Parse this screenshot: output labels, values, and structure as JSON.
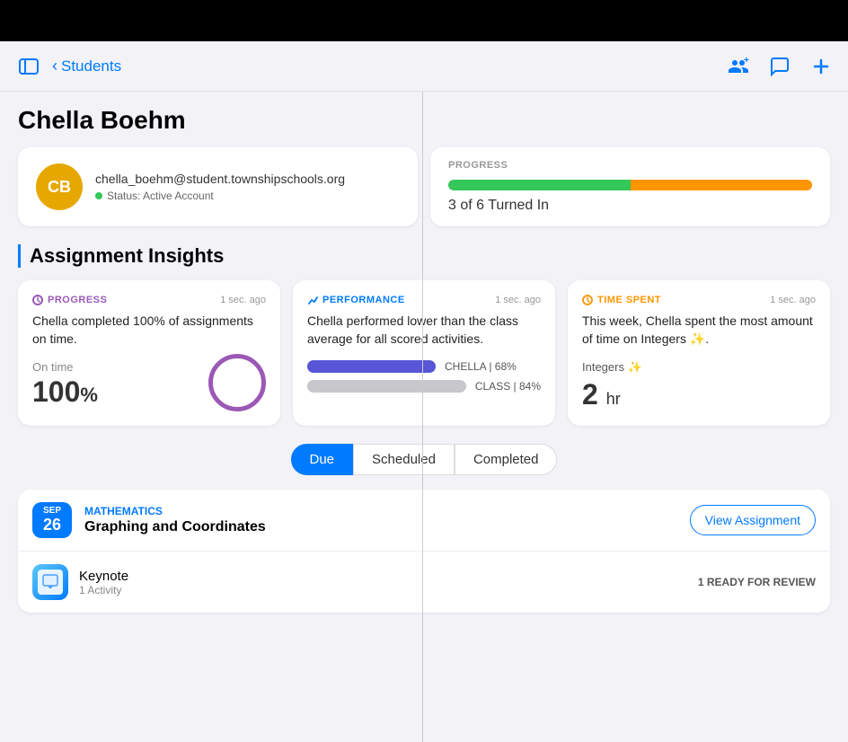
{
  "topBar": {
    "backLabel": "Students",
    "icons": [
      "person-add-icon",
      "chat-icon",
      "plus-icon"
    ]
  },
  "student": {
    "name": "Chella Boehm",
    "initials": "CB",
    "email": "chella_boehm@student.townshipschools.org",
    "statusLabel": "Status: Active Account",
    "avatarBg": "#e6a800"
  },
  "progress": {
    "label": "PROGRESS",
    "text": "3 of 6 Turned In",
    "greenPct": 50,
    "orangePct": 50
  },
  "insights": {
    "sectionTitle": "Assignment Insights",
    "cards": [
      {
        "type": "PROGRESS",
        "typeColor": "#9b59b6",
        "time": "1 sec. ago",
        "desc": "Chella completed 100% of assignments on time.",
        "metricLabel": "On time",
        "metricValue": "100",
        "metricUnit": "%"
      },
      {
        "type": "PERFORMANCE",
        "typeColor": "#007aff",
        "time": "1 sec. ago",
        "desc": "Chella performed lower than the class average for all scored activities.",
        "chellaLabel": "CHELLA | 68%",
        "classLabel": "CLASS | 84%",
        "chellaBarPct": 55,
        "classBarPct": 75
      },
      {
        "type": "TIME SPENT",
        "typeColor": "#ff9500",
        "time": "1 sec. ago",
        "desc": "This week, Chella spent the most amount of time on Integers ✨.",
        "subject": "Integers ✨",
        "value": "2",
        "unit": "hr"
      }
    ]
  },
  "filterTabs": {
    "tabs": [
      "Due",
      "Scheduled",
      "Completed"
    ],
    "activeIndex": 0
  },
  "assignment": {
    "month": "SEP",
    "day": "26",
    "subject": "MATHEMATICS",
    "title": "Graphing and Coordinates",
    "viewBtnLabel": "View Assignment",
    "items": [
      {
        "appName": "Keynote",
        "activityCount": "1 Activity",
        "readyLabel": "1 READY FOR REVIEW"
      }
    ]
  }
}
